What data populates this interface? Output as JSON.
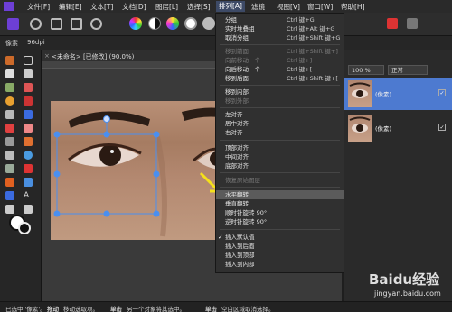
{
  "menubar": {
    "items": [
      "文件[F]",
      "编辑[E]",
      "文本[T]",
      "文档[D]",
      "图层[L]",
      "选择[S]",
      "排列[A]",
      "滤镜",
      "视图[V]",
      "窗口[W]",
      "帮助[H]"
    ],
    "active_index": 6
  },
  "contextbar": {
    "label": "像素",
    "dpi": "96dpi"
  },
  "document": {
    "tab_title": "<未命名> [已修改] (90.0%)"
  },
  "arrange_menu": {
    "items": [
      {
        "label": "分组",
        "shortcut": "Ctrl 键+G",
        "enabled": true
      },
      {
        "label": "实时堆叠组",
        "shortcut": "Ctrl 键+Alt 键+G",
        "enabled": true
      },
      {
        "label": "取消分组",
        "shortcut": "Ctrl 键+Shift 键+G",
        "enabled": true
      },
      {
        "label": "移到前面",
        "shortcut": "Ctrl 键+Shift 键+]",
        "enabled": false
      },
      {
        "label": "向前移动一个",
        "shortcut": "Ctrl 键+]",
        "enabled": false
      },
      {
        "label": "向后移动一个",
        "shortcut": "Ctrl 键+[",
        "enabled": true
      },
      {
        "label": "移到后面",
        "shortcut": "Ctrl 键+Shift 键+[",
        "enabled": true
      },
      {
        "label": "移到内部",
        "shortcut": "",
        "enabled": true
      },
      {
        "label": "移到外部",
        "shortcut": "",
        "enabled": false
      },
      {
        "label": "左对齐",
        "shortcut": "",
        "enabled": true
      },
      {
        "label": "居中对齐",
        "shortcut": "",
        "enabled": true
      },
      {
        "label": "右对齐",
        "shortcut": "",
        "enabled": true
      },
      {
        "label": "顶部对齐",
        "shortcut": "",
        "enabled": true
      },
      {
        "label": "中间对齐",
        "shortcut": "",
        "enabled": true
      },
      {
        "label": "底部对齐",
        "shortcut": "",
        "enabled": true
      },
      {
        "label": "恢复原始图层",
        "shortcut": "",
        "enabled": false
      },
      {
        "label": "水平翻转",
        "shortcut": "",
        "enabled": true,
        "highlighted": true
      },
      {
        "label": "垂直翻转",
        "shortcut": "",
        "enabled": true
      },
      {
        "label": "顺时针旋转 90°",
        "shortcut": "",
        "enabled": true
      },
      {
        "label": "逆时针旋转 90°",
        "shortcut": "",
        "enabled": true
      },
      {
        "label": "插入默认值",
        "shortcut": "",
        "enabled": true,
        "checked": true
      },
      {
        "label": "插入到后面",
        "shortcut": "",
        "enabled": true
      },
      {
        "label": "插入到顶部",
        "shortcut": "",
        "enabled": true
      },
      {
        "label": "插入到内部",
        "shortcut": "",
        "enabled": true
      }
    ]
  },
  "layers_panel": {
    "opacity": "100 %",
    "blend_mode": "正常",
    "layers": [
      {
        "name": "(像素)",
        "selected": true,
        "visible": true
      },
      {
        "name": "(像素)",
        "selected": false,
        "visible": true
      }
    ]
  },
  "statusbar": {
    "text_1": "已选中 '像素'。",
    "bold_1": "拖动",
    "text_2": "移动选取项。",
    "bold_2": "单击",
    "text_3": "另一个对象将其选中。",
    "bold_3": "单击",
    "text_4": "空白区域取消选择。"
  },
  "watermark": {
    "brand": "Baidu经验",
    "url": "jingyan.baidu.com"
  },
  "colors": {
    "accent": "#4d7ad0",
    "menu_highlight": "#5b5b5b",
    "selection_handles": "#4a8ff0",
    "arrow": "#f5e11a"
  }
}
